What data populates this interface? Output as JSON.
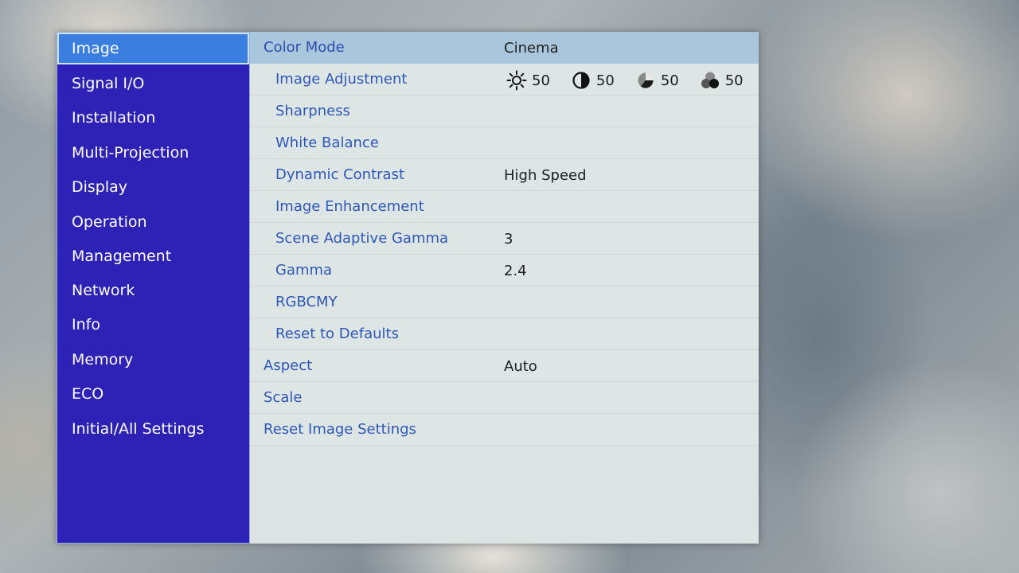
{
  "sidebar": {
    "items": [
      {
        "label": "Image",
        "selected": true
      },
      {
        "label": "Signal I/O"
      },
      {
        "label": "Installation"
      },
      {
        "label": "Multi-Projection"
      },
      {
        "label": "Display"
      },
      {
        "label": "Operation"
      },
      {
        "label": "Management"
      },
      {
        "label": "Network"
      },
      {
        "label": "Info"
      },
      {
        "label": "Memory"
      },
      {
        "label": "ECO"
      },
      {
        "label": "Initial/All Settings"
      }
    ]
  },
  "menu": {
    "color_mode": {
      "label": "Color Mode",
      "value": "Cinema"
    },
    "image_adjustment": {
      "label": "Image Adjustment",
      "brightness": {
        "icon": "brightness-icon",
        "value": "50"
      },
      "contrast": {
        "icon": "contrast-icon",
        "value": "50"
      },
      "color_saturation": {
        "icon": "color-saturation-icon",
        "value": "50"
      },
      "tint": {
        "icon": "tint-icon",
        "value": "50"
      }
    },
    "sharpness": {
      "label": "Sharpness"
    },
    "white_balance": {
      "label": "White Balance"
    },
    "dynamic_contrast": {
      "label": "Dynamic Contrast",
      "value": "High Speed"
    },
    "image_enhancement": {
      "label": "Image Enhancement"
    },
    "scene_adaptive_gamma": {
      "label": "Scene Adaptive Gamma",
      "value": "3"
    },
    "gamma": {
      "label": "Gamma",
      "value": "2.4"
    },
    "rgbcmy": {
      "label": "RGBCMY"
    },
    "reset_to_defaults": {
      "label": "Reset to Defaults"
    },
    "aspect": {
      "label": "Aspect",
      "value": "Auto"
    },
    "scale": {
      "label": "Scale"
    },
    "reset_image_settings": {
      "label": "Reset Image Settings"
    }
  },
  "colors": {
    "sidebar_bg": "#2e21b5",
    "selected_bg": "#3a7fe0",
    "panel_bg": "#dde6e5",
    "header_bg": "#a9c6dc",
    "label_text": "#2f57b7"
  }
}
